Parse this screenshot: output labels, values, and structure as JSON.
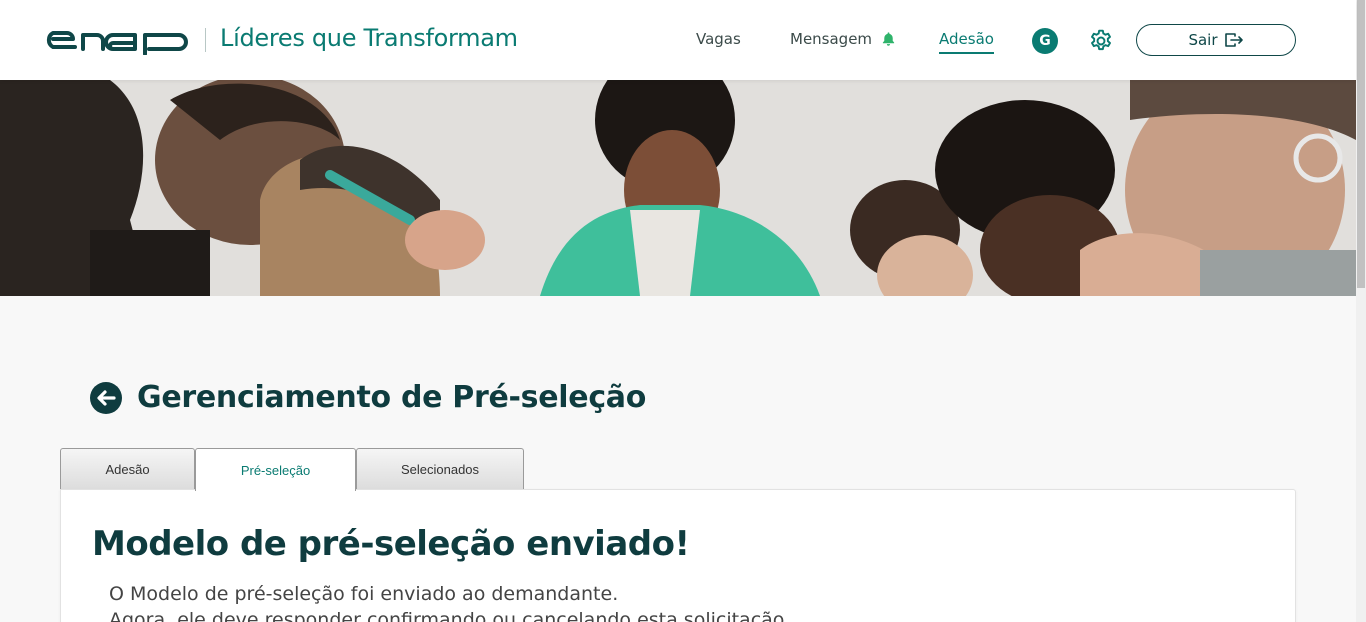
{
  "header": {
    "brand_title": "Líderes que Transformam",
    "nav": {
      "vagas": "Vagas",
      "mensagem": "Mensagem",
      "adesao": "Adesão"
    },
    "avatar_initial": "G",
    "logout_label": "Sair",
    "colors": {
      "accent": "#0a7b72",
      "dark": "#0f3c3f",
      "bell": "#2fb36b"
    }
  },
  "page": {
    "title": "Gerenciamento de Pré-seleção"
  },
  "tabs": [
    {
      "label": "Adesão",
      "active": false
    },
    {
      "label": "Pré-seleção",
      "active": true
    },
    {
      "label": "Selecionados",
      "active": false
    }
  ],
  "card": {
    "title": "Modelo de pré-seleção enviado!",
    "line1": "O Modelo de pré-seleção foi enviado ao demandante.",
    "line2": "Agora, ele deve responder confirmando ou cancelando esta solicitação."
  }
}
